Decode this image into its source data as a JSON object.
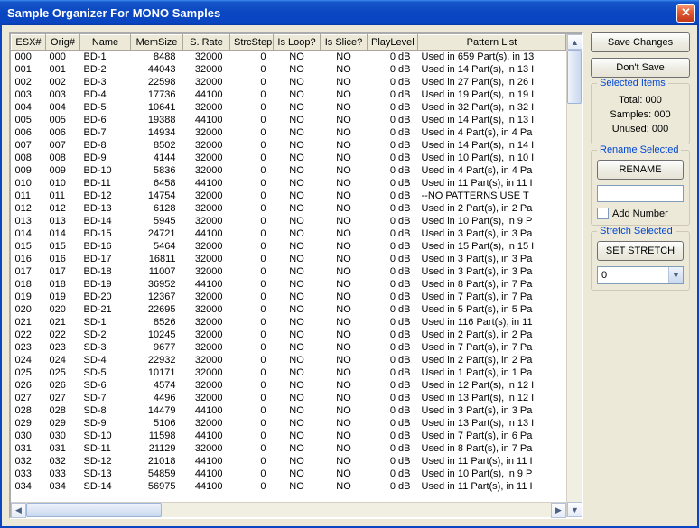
{
  "window": {
    "title": "Sample Organizer For MONO Samples"
  },
  "columns": [
    "ESX#",
    "Orig#",
    "Name",
    "MemSize",
    "S. Rate",
    "StrcStep",
    "Is Loop?",
    "Is Slice?",
    "PlayLevel",
    "Pattern List"
  ],
  "rows": [
    {
      "esx": "000",
      "orig": "000",
      "name": "BD-1",
      "mem": 8488,
      "rate": 32000,
      "step": 0,
      "loop": "NO",
      "slice": "NO",
      "play": "0 dB",
      "pat": "Used in 659 Part(s), in 13"
    },
    {
      "esx": "001",
      "orig": "001",
      "name": "BD-2",
      "mem": 44043,
      "rate": 32000,
      "step": 0,
      "loop": "NO",
      "slice": "NO",
      "play": "0 dB",
      "pat": "Used in 14 Part(s), in 13 I"
    },
    {
      "esx": "002",
      "orig": "002",
      "name": "BD-3",
      "mem": 22598,
      "rate": 32000,
      "step": 0,
      "loop": "NO",
      "slice": "NO",
      "play": "0 dB",
      "pat": "Used in 27 Part(s), in 26 I"
    },
    {
      "esx": "003",
      "orig": "003",
      "name": "BD-4",
      "mem": 17736,
      "rate": 44100,
      "step": 0,
      "loop": "NO",
      "slice": "NO",
      "play": "0 dB",
      "pat": "Used in 19 Part(s), in 19 I"
    },
    {
      "esx": "004",
      "orig": "004",
      "name": "BD-5",
      "mem": 10641,
      "rate": 32000,
      "step": 0,
      "loop": "NO",
      "slice": "NO",
      "play": "0 dB",
      "pat": "Used in 32 Part(s), in 32 I"
    },
    {
      "esx": "005",
      "orig": "005",
      "name": "BD-6",
      "mem": 19388,
      "rate": 44100,
      "step": 0,
      "loop": "NO",
      "slice": "NO",
      "play": "0 dB",
      "pat": "Used in 14 Part(s), in 13 I"
    },
    {
      "esx": "006",
      "orig": "006",
      "name": "BD-7",
      "mem": 14934,
      "rate": 32000,
      "step": 0,
      "loop": "NO",
      "slice": "NO",
      "play": "0 dB",
      "pat": "Used in 4 Part(s), in 4 Pa"
    },
    {
      "esx": "007",
      "orig": "007",
      "name": "BD-8",
      "mem": 8502,
      "rate": 32000,
      "step": 0,
      "loop": "NO",
      "slice": "NO",
      "play": "0 dB",
      "pat": "Used in 14 Part(s), in 14 I"
    },
    {
      "esx": "008",
      "orig": "008",
      "name": "BD-9",
      "mem": 4144,
      "rate": 32000,
      "step": 0,
      "loop": "NO",
      "slice": "NO",
      "play": "0 dB",
      "pat": "Used in 10 Part(s), in 10 I"
    },
    {
      "esx": "009",
      "orig": "009",
      "name": "BD-10",
      "mem": 5836,
      "rate": 32000,
      "step": 0,
      "loop": "NO",
      "slice": "NO",
      "play": "0 dB",
      "pat": "Used in 4 Part(s), in 4 Pa"
    },
    {
      "esx": "010",
      "orig": "010",
      "name": "BD-11",
      "mem": 6458,
      "rate": 44100,
      "step": 0,
      "loop": "NO",
      "slice": "NO",
      "play": "0 dB",
      "pat": "Used in 11 Part(s), in 11 I"
    },
    {
      "esx": "011",
      "orig": "011",
      "name": "BD-12",
      "mem": 14754,
      "rate": 32000,
      "step": 0,
      "loop": "NO",
      "slice": "NO",
      "play": "0 dB",
      "pat": "--NO PATTERNS USE T"
    },
    {
      "esx": "012",
      "orig": "012",
      "name": "BD-13",
      "mem": 6128,
      "rate": 32000,
      "step": 0,
      "loop": "NO",
      "slice": "NO",
      "play": "0 dB",
      "pat": "Used in 2 Part(s), in 2 Pa"
    },
    {
      "esx": "013",
      "orig": "013",
      "name": "BD-14",
      "mem": 5945,
      "rate": 32000,
      "step": 0,
      "loop": "NO",
      "slice": "NO",
      "play": "0 dB",
      "pat": "Used in 10 Part(s), in 9 P"
    },
    {
      "esx": "014",
      "orig": "014",
      "name": "BD-15",
      "mem": 24721,
      "rate": 44100,
      "step": 0,
      "loop": "NO",
      "slice": "NO",
      "play": "0 dB",
      "pat": "Used in 3 Part(s), in 3 Pa"
    },
    {
      "esx": "015",
      "orig": "015",
      "name": "BD-16",
      "mem": 5464,
      "rate": 32000,
      "step": 0,
      "loop": "NO",
      "slice": "NO",
      "play": "0 dB",
      "pat": "Used in 15 Part(s), in 15 I"
    },
    {
      "esx": "016",
      "orig": "016",
      "name": "BD-17",
      "mem": 16811,
      "rate": 32000,
      "step": 0,
      "loop": "NO",
      "slice": "NO",
      "play": "0 dB",
      "pat": "Used in 3 Part(s), in 3 Pa"
    },
    {
      "esx": "017",
      "orig": "017",
      "name": "BD-18",
      "mem": 11007,
      "rate": 32000,
      "step": 0,
      "loop": "NO",
      "slice": "NO",
      "play": "0 dB",
      "pat": "Used in 3 Part(s), in 3 Pa"
    },
    {
      "esx": "018",
      "orig": "018",
      "name": "BD-19",
      "mem": 36952,
      "rate": 44100,
      "step": 0,
      "loop": "NO",
      "slice": "NO",
      "play": "0 dB",
      "pat": "Used in 8 Part(s), in 7 Pa"
    },
    {
      "esx": "019",
      "orig": "019",
      "name": "BD-20",
      "mem": 12367,
      "rate": 32000,
      "step": 0,
      "loop": "NO",
      "slice": "NO",
      "play": "0 dB",
      "pat": "Used in 7 Part(s), in 7 Pa"
    },
    {
      "esx": "020",
      "orig": "020",
      "name": "BD-21",
      "mem": 22695,
      "rate": 32000,
      "step": 0,
      "loop": "NO",
      "slice": "NO",
      "play": "0 dB",
      "pat": "Used in 5 Part(s), in 5 Pa"
    },
    {
      "esx": "021",
      "orig": "021",
      "name": "SD-1",
      "mem": 8526,
      "rate": 32000,
      "step": 0,
      "loop": "NO",
      "slice": "NO",
      "play": "0 dB",
      "pat": "Used in 116 Part(s), in 11"
    },
    {
      "esx": "022",
      "orig": "022",
      "name": "SD-2",
      "mem": 10245,
      "rate": 32000,
      "step": 0,
      "loop": "NO",
      "slice": "NO",
      "play": "0 dB",
      "pat": "Used in 2 Part(s), in 2 Pa"
    },
    {
      "esx": "023",
      "orig": "023",
      "name": "SD-3",
      "mem": 9677,
      "rate": 32000,
      "step": 0,
      "loop": "NO",
      "slice": "NO",
      "play": "0 dB",
      "pat": "Used in 7 Part(s), in 7 Pa"
    },
    {
      "esx": "024",
      "orig": "024",
      "name": "SD-4",
      "mem": 22932,
      "rate": 32000,
      "step": 0,
      "loop": "NO",
      "slice": "NO",
      "play": "0 dB",
      "pat": "Used in 2 Part(s), in 2 Pa"
    },
    {
      "esx": "025",
      "orig": "025",
      "name": "SD-5",
      "mem": 10171,
      "rate": 32000,
      "step": 0,
      "loop": "NO",
      "slice": "NO",
      "play": "0 dB",
      "pat": "Used in 1 Part(s), in 1 Pa"
    },
    {
      "esx": "026",
      "orig": "026",
      "name": "SD-6",
      "mem": 4574,
      "rate": 32000,
      "step": 0,
      "loop": "NO",
      "slice": "NO",
      "play": "0 dB",
      "pat": "Used in 12 Part(s), in 12 I"
    },
    {
      "esx": "027",
      "orig": "027",
      "name": "SD-7",
      "mem": 4496,
      "rate": 32000,
      "step": 0,
      "loop": "NO",
      "slice": "NO",
      "play": "0 dB",
      "pat": "Used in 13 Part(s), in 12 I"
    },
    {
      "esx": "028",
      "orig": "028",
      "name": "SD-8",
      "mem": 14479,
      "rate": 44100,
      "step": 0,
      "loop": "NO",
      "slice": "NO",
      "play": "0 dB",
      "pat": "Used in 3 Part(s), in 3 Pa"
    },
    {
      "esx": "029",
      "orig": "029",
      "name": "SD-9",
      "mem": 5106,
      "rate": 32000,
      "step": 0,
      "loop": "NO",
      "slice": "NO",
      "play": "0 dB",
      "pat": "Used in 13 Part(s), in 13 I"
    },
    {
      "esx": "030",
      "orig": "030",
      "name": "SD-10",
      "mem": 11598,
      "rate": 44100,
      "step": 0,
      "loop": "NO",
      "slice": "NO",
      "play": "0 dB",
      "pat": "Used in 7 Part(s), in 6 Pa"
    },
    {
      "esx": "031",
      "orig": "031",
      "name": "SD-11",
      "mem": 21129,
      "rate": 32000,
      "step": 0,
      "loop": "NO",
      "slice": "NO",
      "play": "0 dB",
      "pat": "Used in 8 Part(s), in 7 Pa"
    },
    {
      "esx": "032",
      "orig": "032",
      "name": "SD-12",
      "mem": 21018,
      "rate": 44100,
      "step": 0,
      "loop": "NO",
      "slice": "NO",
      "play": "0 dB",
      "pat": "Used in 11 Part(s), in 11 I"
    },
    {
      "esx": "033",
      "orig": "033",
      "name": "SD-13",
      "mem": 54859,
      "rate": 44100,
      "step": 0,
      "loop": "NO",
      "slice": "NO",
      "play": "0 dB",
      "pat": "Used in 10 Part(s), in 9 P"
    },
    {
      "esx": "034",
      "orig": "034",
      "name": "SD-14",
      "mem": 56975,
      "rate": 44100,
      "step": 0,
      "loop": "NO",
      "slice": "NO",
      "play": "0 dB",
      "pat": "Used in 11 Part(s), in 11 I"
    }
  ],
  "side": {
    "save": "Save Changes",
    "dontsave": "Don't Save",
    "selected": {
      "title": "Selected Items",
      "total_label": "Total:",
      "total_value": "000",
      "samples_label": "Samples:",
      "samples_value": "000",
      "unused_label": "Unused:",
      "unused_value": "000"
    },
    "rename": {
      "title": "Rename Selected",
      "button": "RENAME",
      "input": "",
      "addnum": "Add Number"
    },
    "stretch": {
      "title": "Stretch Selected",
      "button": "SET STRETCH",
      "value": "0"
    }
  }
}
